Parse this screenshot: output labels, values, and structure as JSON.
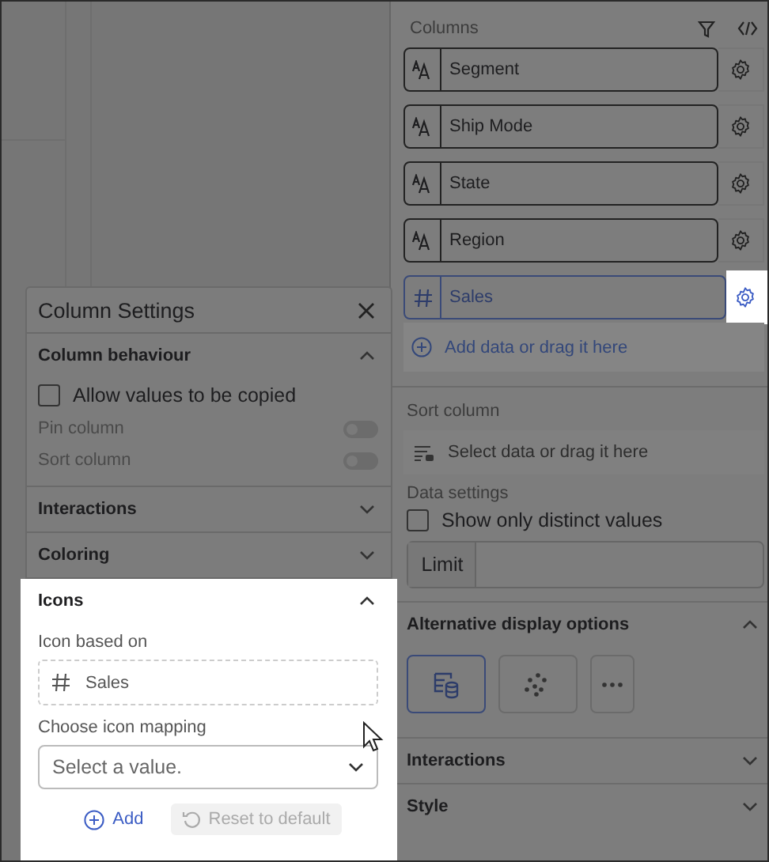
{
  "columns_panel": {
    "title": "Columns",
    "columns": [
      {
        "name": "Segment",
        "kind": "text",
        "selected": false
      },
      {
        "name": "Ship Mode",
        "kind": "text",
        "selected": false
      },
      {
        "name": "State",
        "kind": "text",
        "selected": false
      },
      {
        "name": "Region",
        "kind": "text",
        "selected": false
      },
      {
        "name": "Sales",
        "kind": "number",
        "selected": true
      }
    ],
    "add_label": "Add data or drag it here"
  },
  "sort_column": {
    "title": "Sort column",
    "placeholder": "Select data or drag it here"
  },
  "data_settings": {
    "title": "Data settings",
    "distinct": {
      "label": "Show only distinct values",
      "checked": false
    },
    "limit": {
      "label": "Limit"
    }
  },
  "display_options": {
    "title": "Alternative display options",
    "expanded": true,
    "options": [
      {
        "kind": "table",
        "selected": true
      },
      {
        "kind": "scatter",
        "selected": false
      },
      {
        "kind": "more",
        "selected": false
      }
    ]
  },
  "sections": [
    {
      "title": "Interactions",
      "expanded": false
    },
    {
      "title": "Style",
      "expanded": false
    }
  ],
  "popup": {
    "title": "Column Settings",
    "behaviour": {
      "title": "Column behaviour",
      "expanded": true,
      "copy": {
        "label": "Allow values to be copied",
        "checked": false
      },
      "toggles": [
        {
          "label": "Pin column",
          "on": false,
          "disabled": true
        },
        {
          "label": "Sort column",
          "on": false,
          "disabled": true
        }
      ]
    },
    "sections": [
      {
        "title": "Interactions",
        "expanded": false
      },
      {
        "title": "Coloring",
        "expanded": false
      }
    ],
    "icons": {
      "title": "Icons",
      "expanded": true,
      "highlighted": true,
      "based_on_label": "Icon based on",
      "based_on": {
        "name": "Sales",
        "kind": "number"
      },
      "mapping_label": "Choose icon mapping",
      "mapping": {
        "placeholder": "Select a value."
      },
      "add": "Add",
      "reset": {
        "label": "Reset to default",
        "disabled": true
      }
    }
  }
}
